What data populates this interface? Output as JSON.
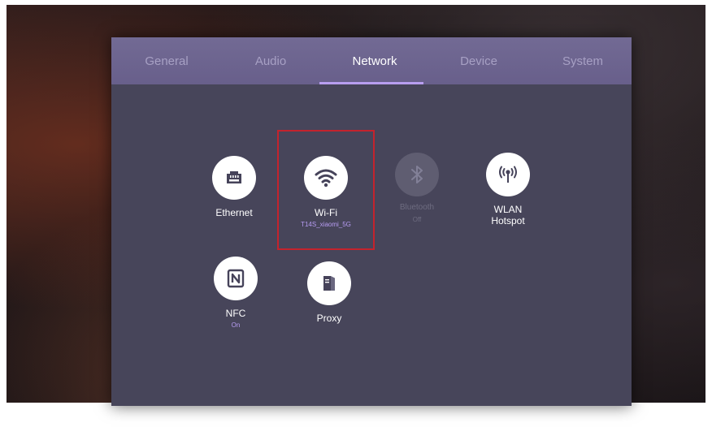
{
  "tabs": [
    {
      "label": "General"
    },
    {
      "label": "Audio"
    },
    {
      "label": "Network"
    },
    {
      "label": "Device"
    },
    {
      "label": "System"
    }
  ],
  "active_tab": "Network",
  "colors": {
    "panel": "#47455a",
    "tab_bar": "#6e6590",
    "accent": "#b89ef0",
    "selection_border": "#c4232d"
  },
  "network_items": {
    "ethernet": {
      "label": "Ethernet",
      "icon": "ethernet-port-icon"
    },
    "wifi": {
      "label": "Wi-Fi",
      "status": "T14S_xiaomi_5G",
      "icon": "wifi-icon"
    },
    "bluetooth": {
      "label": "Bluetooth",
      "status": "Off",
      "icon": "bluetooth-icon"
    },
    "hotspot": {
      "label": "WLAN Hotspot",
      "icon": "hotspot-antenna-icon"
    },
    "nfc": {
      "label": "NFC",
      "status": "On",
      "icon": "nfc-icon"
    },
    "proxy": {
      "label": "Proxy",
      "icon": "proxy-server-icon"
    }
  }
}
